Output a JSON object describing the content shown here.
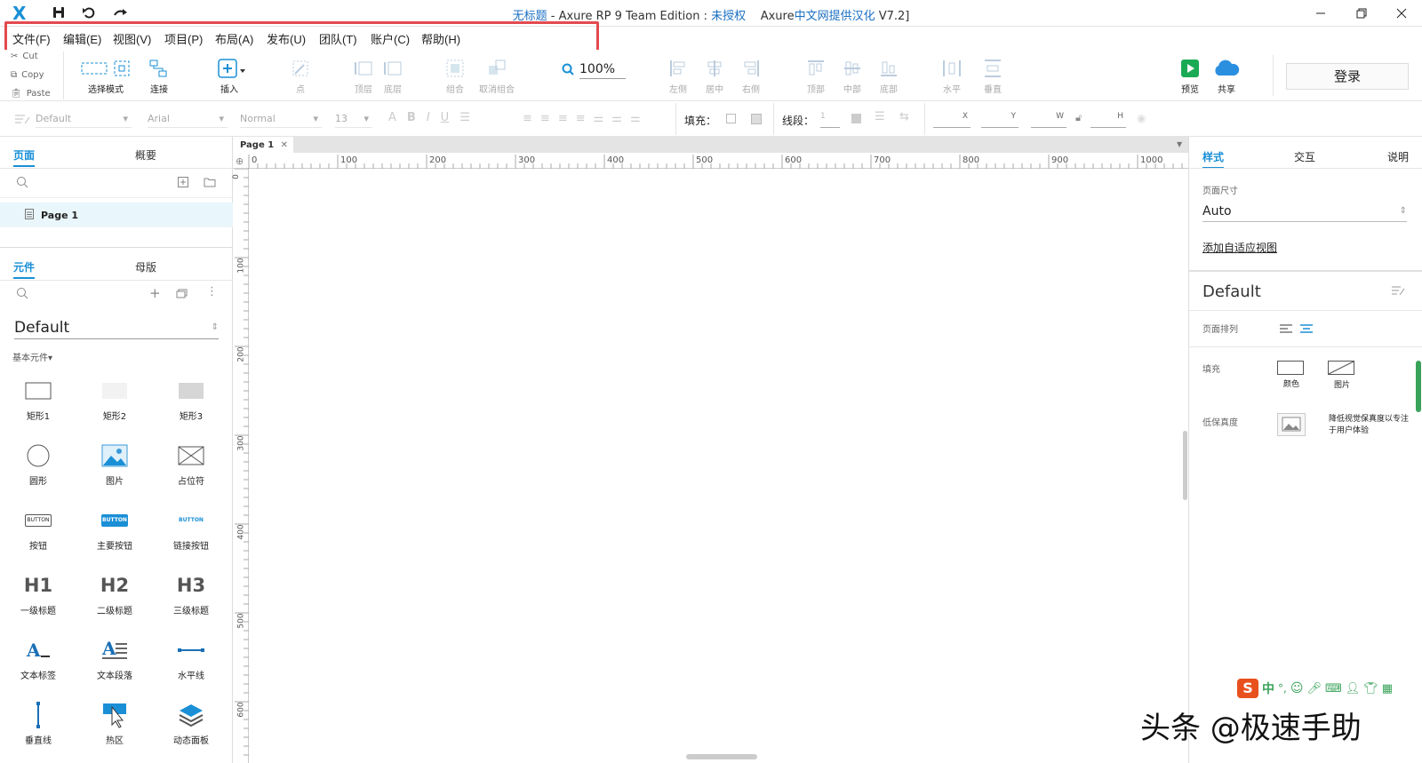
{
  "titlebar": {
    "doc_title": "无标题",
    "app_name": " - Axure RP 9 Team Edition : ",
    "license": "未授权",
    "localization_prefix": "Axure",
    "localization_accent": "中文网提供汉化",
    "localization_suffix": " V7.2]"
  },
  "menu": [
    "文件(F)",
    "编辑(E)",
    "视图(V)",
    "项目(P)",
    "布局(A)",
    "发布(U)",
    "团队(T)",
    "账户(C)",
    "帮助(H)"
  ],
  "clipboard": {
    "cut": "Cut",
    "copy": "Copy",
    "paste": "Paste"
  },
  "toolbar": {
    "select_mode": "选择模式",
    "connect": "连接",
    "insert": "插入",
    "point": "点",
    "top_layer": "顶层",
    "bottom_layer": "底层",
    "group": "组合",
    "ungroup": "取消组合",
    "zoom": "100%",
    "left": "左侧",
    "center": "居中",
    "right": "右侧",
    "top": "顶部",
    "middle": "中部",
    "bottom": "底部",
    "horizontal": "水平",
    "vertical": "垂直",
    "preview": "预览",
    "share": "共享",
    "login": "登录"
  },
  "format": {
    "style": "Default",
    "font": "Arial",
    "weight": "Normal",
    "size": "13",
    "fill_label": "填充：",
    "stroke_label": "线段：",
    "stroke_value": "1",
    "x_label": "X",
    "y_label": "Y",
    "w_label": "W",
    "h_label": "H"
  },
  "left": {
    "tab_pages": "页面",
    "tab_outline": "概要",
    "page_name": "Page 1",
    "tab_widgets": "元件",
    "tab_masters": "母版",
    "library": "Default",
    "section": "基本元件▾",
    "widgets": [
      "矩形1",
      "矩形2",
      "矩形3",
      "圆形",
      "图片",
      "占位符",
      "按钮",
      "主要按钮",
      "链接按钮",
      "一级标题",
      "二级标题",
      "三级标题",
      "文本标签",
      "文本段落",
      "水平线",
      "垂直线",
      "热区",
      "动态面板"
    ],
    "button_text": "BUTTON",
    "h1": "H1",
    "h2": "H2",
    "h3": "H3"
  },
  "canvas": {
    "page_tab": "Page 1",
    "ruler_h": [
      "0",
      "100",
      "200",
      "300",
      "400",
      "500",
      "600",
      "700",
      "800",
      "900",
      "1000"
    ],
    "ruler_v": [
      "0",
      "100",
      "200",
      "300",
      "400",
      "500",
      "600"
    ]
  },
  "right": {
    "tab_style": "样式",
    "tab_interact": "交互",
    "tab_notes": "说明",
    "page_size_label": "页面尺寸",
    "page_size_value": "Auto",
    "adaptive_link": "添加自适应视图",
    "style_name": "Default",
    "page_align_label": "页面排列",
    "fill_label": "填充",
    "fill_color": "颜色",
    "fill_image": "图片",
    "lowfi_label": "低保真度",
    "lowfi_desc_1": "降低视觉保真度以专注",
    "lowfi_desc_2": "于用户体验"
  },
  "watermark": "头条 @极速手助",
  "colors": {
    "accent": "#1a8fd6",
    "highlight": "#e24a4f",
    "selected_row": "#e9f6fb",
    "preview_green": "#1aaa55",
    "share_blue": "#2b8fe0"
  }
}
